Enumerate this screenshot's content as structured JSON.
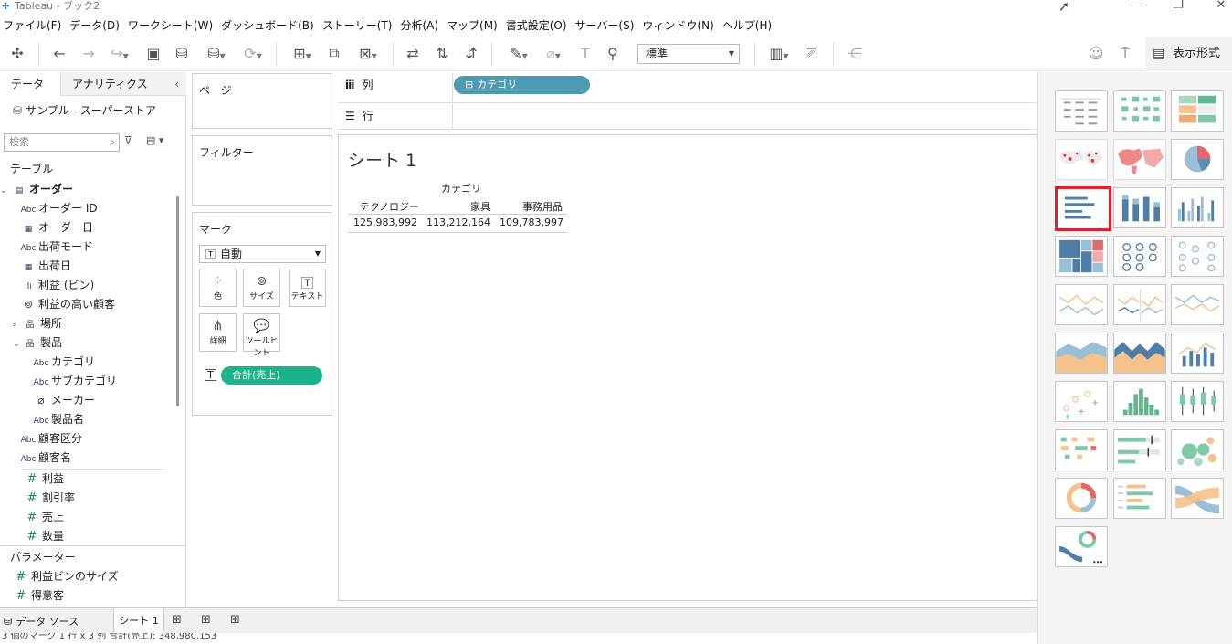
{
  "window": {
    "title": "Tableau - ブック2"
  },
  "menu": [
    "ファイル(F)",
    "データ(D)",
    "ワークシート(W)",
    "ダッシュボード(B)",
    "ストーリー(T)",
    "分析(A)",
    "マップ(M)",
    "書式設定(O)",
    "サーバー(S)",
    "ウィンドウ(N)",
    "ヘルプ(H)"
  ],
  "toolbar": {
    "fit_value": "標準",
    "show_me_label": "表示形式"
  },
  "data_pane": {
    "tabs": {
      "data": "データ",
      "analytics": "アナリティクス"
    },
    "datasource": "サンプル - スーパーストア",
    "search_placeholder": "検索",
    "tables_title": "テーブル",
    "table_name": "オーダー",
    "dimensions": [
      {
        "type": "Abc",
        "name": "オーダー ID"
      },
      {
        "type": "date",
        "name": "オーダー日"
      },
      {
        "type": "Abc",
        "name": "出荷モード"
      },
      {
        "type": "date",
        "name": "出荷日"
      },
      {
        "type": "bin",
        "name": "利益 (ビン)"
      },
      {
        "type": "set",
        "name": "利益の高い顧客"
      },
      {
        "type": "hier",
        "name": "場所"
      },
      {
        "type": "hier",
        "name": "製品"
      },
      {
        "type": "Abc",
        "name": "カテゴリ"
      },
      {
        "type": "Abc",
        "name": "サブカテゴリ"
      },
      {
        "type": "clip",
        "name": "メーカー"
      },
      {
        "type": "Abc",
        "name": "製品名"
      },
      {
        "type": "Abc",
        "name": "顧客区分"
      },
      {
        "type": "Abc",
        "name": "顧客名"
      }
    ],
    "measures": [
      "利益",
      "割引率",
      "売上",
      "数量"
    ],
    "parameters_title": "パラメーター",
    "parameters": [
      "利益ビンのサイズ",
      "得意客"
    ]
  },
  "shelves": {
    "pages": "ページ",
    "filters": "フィルター",
    "marks": "マーク",
    "mark_type": "自動",
    "mark_buttons": [
      "色",
      "サイズ",
      "テキスト",
      "詳細",
      "ツールヒント"
    ],
    "mark_pill": "合計(売上)",
    "columns_label": "列",
    "rows_label": "行",
    "column_pill": "カテゴリ"
  },
  "view": {
    "sheet_title": "シート 1",
    "header": "カテゴリ",
    "table": {
      "columns": [
        "テクノロジー",
        "家具",
        "事務用品"
      ],
      "values": [
        "125,983,992",
        "113,212,164",
        "109,783,997"
      ]
    }
  },
  "bottom": {
    "datasource_tab": "データ ソース",
    "sheet_tab": "シート 1",
    "status": "3 個のマーク   1 行 x 3 列   合計(売上): 348,980,153"
  },
  "colors": {
    "pill_blue": "#4e9ab2",
    "pill_green": "#1ab38a",
    "selected_border": "#e0202a"
  }
}
